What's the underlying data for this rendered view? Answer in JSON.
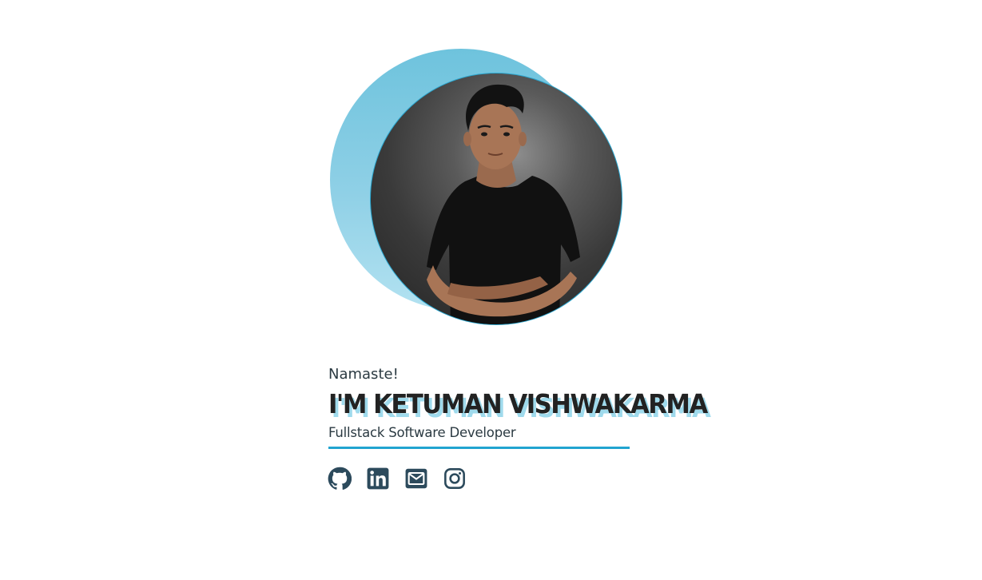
{
  "hero": {
    "greeting": "Namaste!",
    "name": "I'M KETUMAN VISHWAKARMA",
    "role": "Fullstack Software Developer"
  },
  "avatar": {
    "alt": "Ketuman Vishwakarma portrait"
  },
  "socials": [
    {
      "icon": "github-icon",
      "label": "GitHub"
    },
    {
      "icon": "linkedin-icon",
      "label": "LinkedIn"
    },
    {
      "icon": "mail-icon",
      "label": "Email"
    },
    {
      "icon": "instagram-icon",
      "label": "Instagram"
    }
  ],
  "colors": {
    "accent": "#21a4d0",
    "blob": "#7cc9e2",
    "text": "#2b3a42",
    "name_shadow": "#9fdaec",
    "icon": "#2c4a5c"
  }
}
